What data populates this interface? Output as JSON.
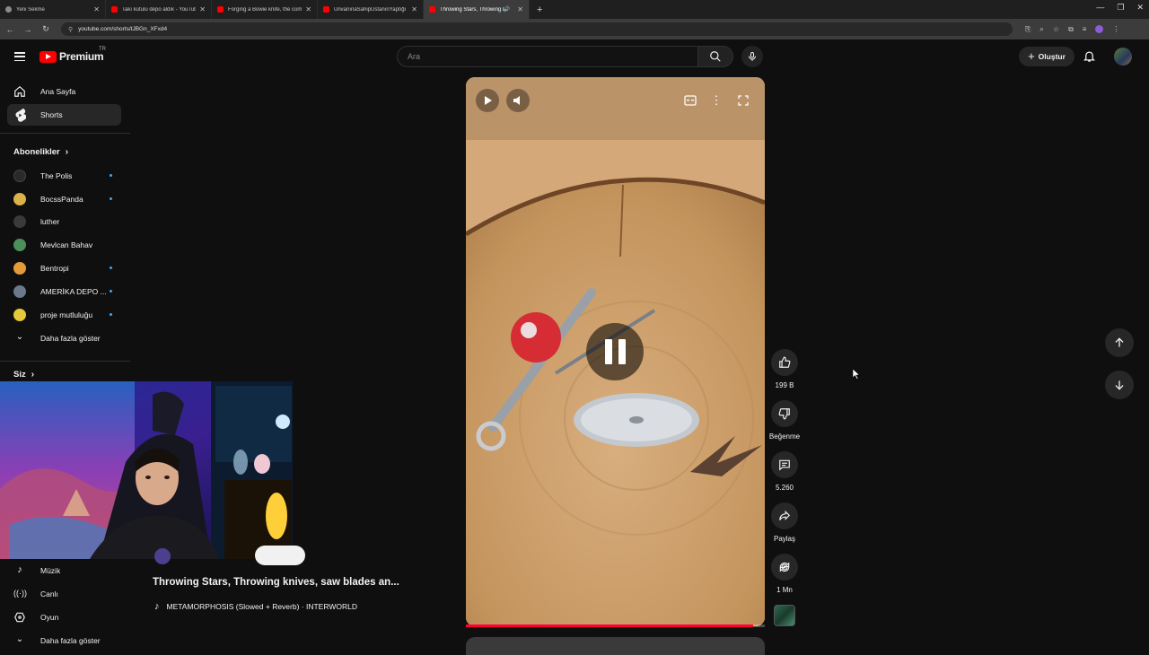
{
  "browser": {
    "tabs": [
      {
        "title": "Yeni Sekme",
        "favicon": "globe-icon"
      },
      {
        "title": "Takı kutulu depo aldık - YouTube",
        "favicon": "youtube-icon"
      },
      {
        "title": "Forging a Bowie knife, the com",
        "favicon": "youtube-icon"
      },
      {
        "title": "ÜnvanınaSahipUstanınYaptığı",
        "favicon": "youtube-icon"
      },
      {
        "title": "Throwing Stars, Throwing k",
        "favicon": "youtube-icon",
        "active": true
      }
    ],
    "url": "youtube.com/shorts/tJBGn_XFxd4"
  },
  "masthead": {
    "logo_text": "Premium",
    "logo_region": "TR",
    "search_placeholder": "Ara",
    "create_label": "Oluştur"
  },
  "sidebar": {
    "main": [
      {
        "label": "Ana Sayfa",
        "icon": "home-icon"
      },
      {
        "label": "Shorts",
        "icon": "shorts-icon",
        "active": true
      }
    ],
    "subscriptions_title": "Abonelikler",
    "subscriptions": [
      {
        "name": "The Polis",
        "new": true,
        "color": "#2a2a2a"
      },
      {
        "name": "BocssPanda",
        "new": true,
        "color": "#d9b24a"
      },
      {
        "name": "luther",
        "new": false,
        "color": "#3a3a3a"
      },
      {
        "name": "Mevlcan Bahav",
        "new": false,
        "color": "#4c8f5a"
      },
      {
        "name": "Bentropi",
        "new": true,
        "color": "#e59a3a"
      },
      {
        "name": "AMERİKA DEPO ...",
        "new": true,
        "color": "#6a7a8a"
      },
      {
        "name": "proje mutluluğu",
        "new": true,
        "color": "#e5c93a"
      }
    ],
    "show_more": "Daha fazla göster",
    "you_title": "Siz",
    "explore": [
      {
        "label": "Müzik",
        "icon": "music-note-icon"
      },
      {
        "label": "Canlı",
        "icon": "live-icon"
      },
      {
        "label": "Oyun",
        "icon": "gamepad-icon"
      }
    ],
    "show_more_2": "Daha fazla göster"
  },
  "short": {
    "title": "Throwing Stars, Throwing knives, saw blades an...",
    "music": "METAMORPHOSIS (Slowed + Reverb) · INTERWORLD",
    "progress": 0.96,
    "actions": [
      {
        "icon": "like-icon",
        "label": "199 B"
      },
      {
        "icon": "dislike-icon",
        "label": "Beğenme"
      },
      {
        "icon": "comment-icon",
        "label": "5.260"
      },
      {
        "icon": "share-icon",
        "label": "Paylaş"
      },
      {
        "icon": "remix-icon",
        "label": "1 Mn"
      }
    ]
  },
  "colors": {
    "accent": "#ff0000",
    "progress": "#ff0033",
    "background": "#0f0f0f"
  }
}
